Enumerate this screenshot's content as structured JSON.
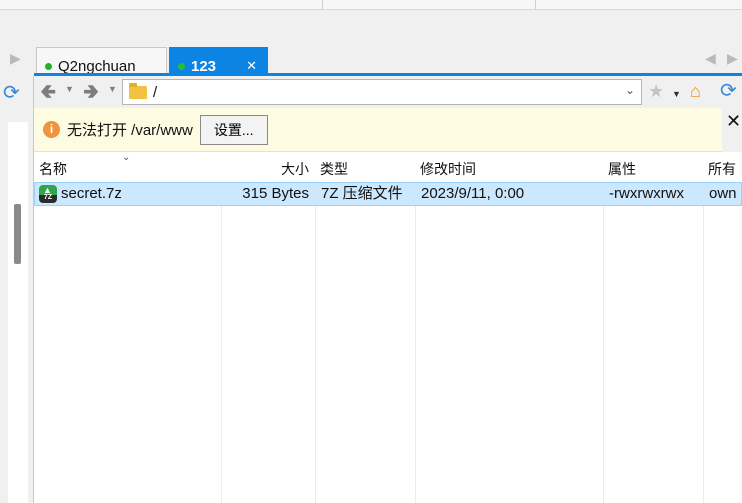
{
  "tabs": [
    {
      "label": "Q2ngchuan",
      "active": false
    },
    {
      "label": "123",
      "active": true
    }
  ],
  "toolbar": {
    "path": "/",
    "back_icon": "back-arrow-icon",
    "forward_icon": "forward-arrow-icon"
  },
  "error_bar": {
    "message": "无法打开 /var/www",
    "settings_button": "设置...",
    "info_icon": "i"
  },
  "table": {
    "columns": [
      "名称",
      "大小",
      "类型",
      "修改时间",
      "属性",
      "所有"
    ],
    "rows": [
      {
        "name": "secret.7z",
        "size": "315 Bytes",
        "type": "7Z 压缩文件",
        "modified": "2023/9/11, 0:00",
        "attrs": "-rwxrwxrwx",
        "owner": "own",
        "icon_label": "7Z"
      }
    ]
  },
  "colors": {
    "accent": "#0c84e4",
    "selection": "#cce8ff",
    "warning_bg": "#fdfbe2"
  }
}
